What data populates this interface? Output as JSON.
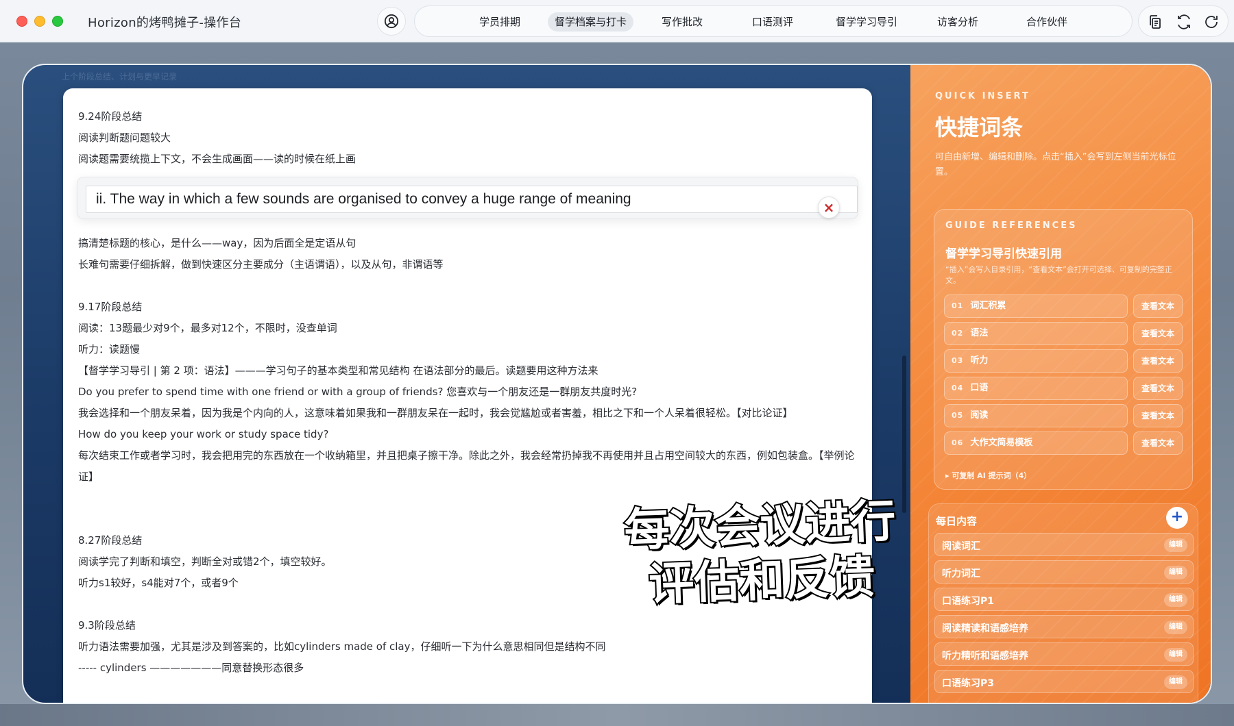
{
  "app_title": "Horizon的烤鸭摊子-操作台",
  "nav": {
    "items": [
      {
        "label": "学员排期"
      },
      {
        "label": "督学档案与打卡",
        "active": true
      },
      {
        "label": "写作批改"
      },
      {
        "label": "口语测评"
      },
      {
        "label": "督学学习导引"
      },
      {
        "label": "访客分析"
      },
      {
        "label": "合作伙伴"
      }
    ]
  },
  "toolbar_icons": [
    "copy-icon",
    "sync-icon",
    "refresh-icon"
  ],
  "window_caption": "上个阶段总结、计划与更早记录",
  "notes": {
    "block1": [
      "9.24阶段总结",
      "阅读判断题问题较大",
      "阅读题需要统揽上下文，不会生成画面——读的时候在纸上画"
    ],
    "highlight_text": "ii. The way in which a few sounds are organised to convey a huge range of meaning",
    "highlight_close": "×",
    "block2": [
      "搞清楚标题的核心，是什么——way，因为后面全是定语从句",
      "长难句需要仔细拆解，做到快速区分主要成分（主语谓语），以及从句，非谓语等"
    ],
    "block3": [
      "9.17阶段总结",
      "阅读：13题最少对9个，最多对12个，不限时，没查单词",
      "听力：读题慢",
      "【督学学习导引 | 第 2 项：语法】———学习句子的基本类型和常见结构 在语法部分的最后。读题要用这种方法来",
      "Do you prefer to spend time with one friend or with a group of friends? 您喜欢与一个朋友还是一群朋友共度时光?"
    ],
    "para1": "我会选择和一个朋友呆着，因为我是个内向的人，这意味着如果我和一群朋友呆在一起时，我会觉尴尬或者害羞，相比之下和一个人呆着很轻松。【对比论证】",
    "line_q2": "How do you keep your work or study space tidy?",
    "para2": "每次结束工作或者学习时，我会把用完的东西放在一个收纳箱里，并且把桌子擦干净。除此之外，我会经常扔掉我不再使用并且占用空间较大的东西，例如包装盒。【举例论证】",
    "block4": [
      "8.27阶段总结",
      "阅读学完了判断和填空，判断全对或错2个，填空较好。",
      "听力s1较好，s4能对7个，或者9个"
    ],
    "block5": [
      "9.3阶段总结",
      "听力语法需要加强，尤其是涉及到答案的，比如cylinders made of clay，仔细听一下为什么意思相同但是结构不同",
      "----- cylinders ———————同意替换形态很多"
    ]
  },
  "quick_insert": {
    "label": "QUICK INSERT",
    "title": "快捷词条",
    "desc": "可自由新增、编辑和删除。点击“插入”会写到左侧当前光标位置。"
  },
  "guide_refs": {
    "label": "GUIDE REFERENCES",
    "title": "督学学习导引快速引用",
    "desc": "“插入”会写入目录引用，“查看文本”会打开可选择、可复制的完整正文。",
    "items": [
      {
        "num": "01",
        "label": "词汇积累",
        "action": "查看文本"
      },
      {
        "num": "02",
        "label": "语法",
        "action": "查看文本"
      },
      {
        "num": "03",
        "label": "听力",
        "action": "查看文本"
      },
      {
        "num": "04",
        "label": "口语",
        "action": "查看文本"
      },
      {
        "num": "05",
        "label": "阅读",
        "action": "查看文本"
      },
      {
        "num": "06",
        "label": "大作文简易模板",
        "action": "查看文本"
      }
    ],
    "ai_prompts": "▸ 可复制 AI 提示词（4）"
  },
  "daily": {
    "title": "每日内容",
    "add_label": "+",
    "edit_label": "编辑",
    "items": [
      "阅读词汇",
      "听力词汇",
      "口语练习P1",
      "阅读精读和语感培养",
      "听力精听和语感培养",
      "口语练习P3"
    ]
  },
  "subtitle_lines": [
    "每次会议进行",
    "评估和反馈"
  ]
}
